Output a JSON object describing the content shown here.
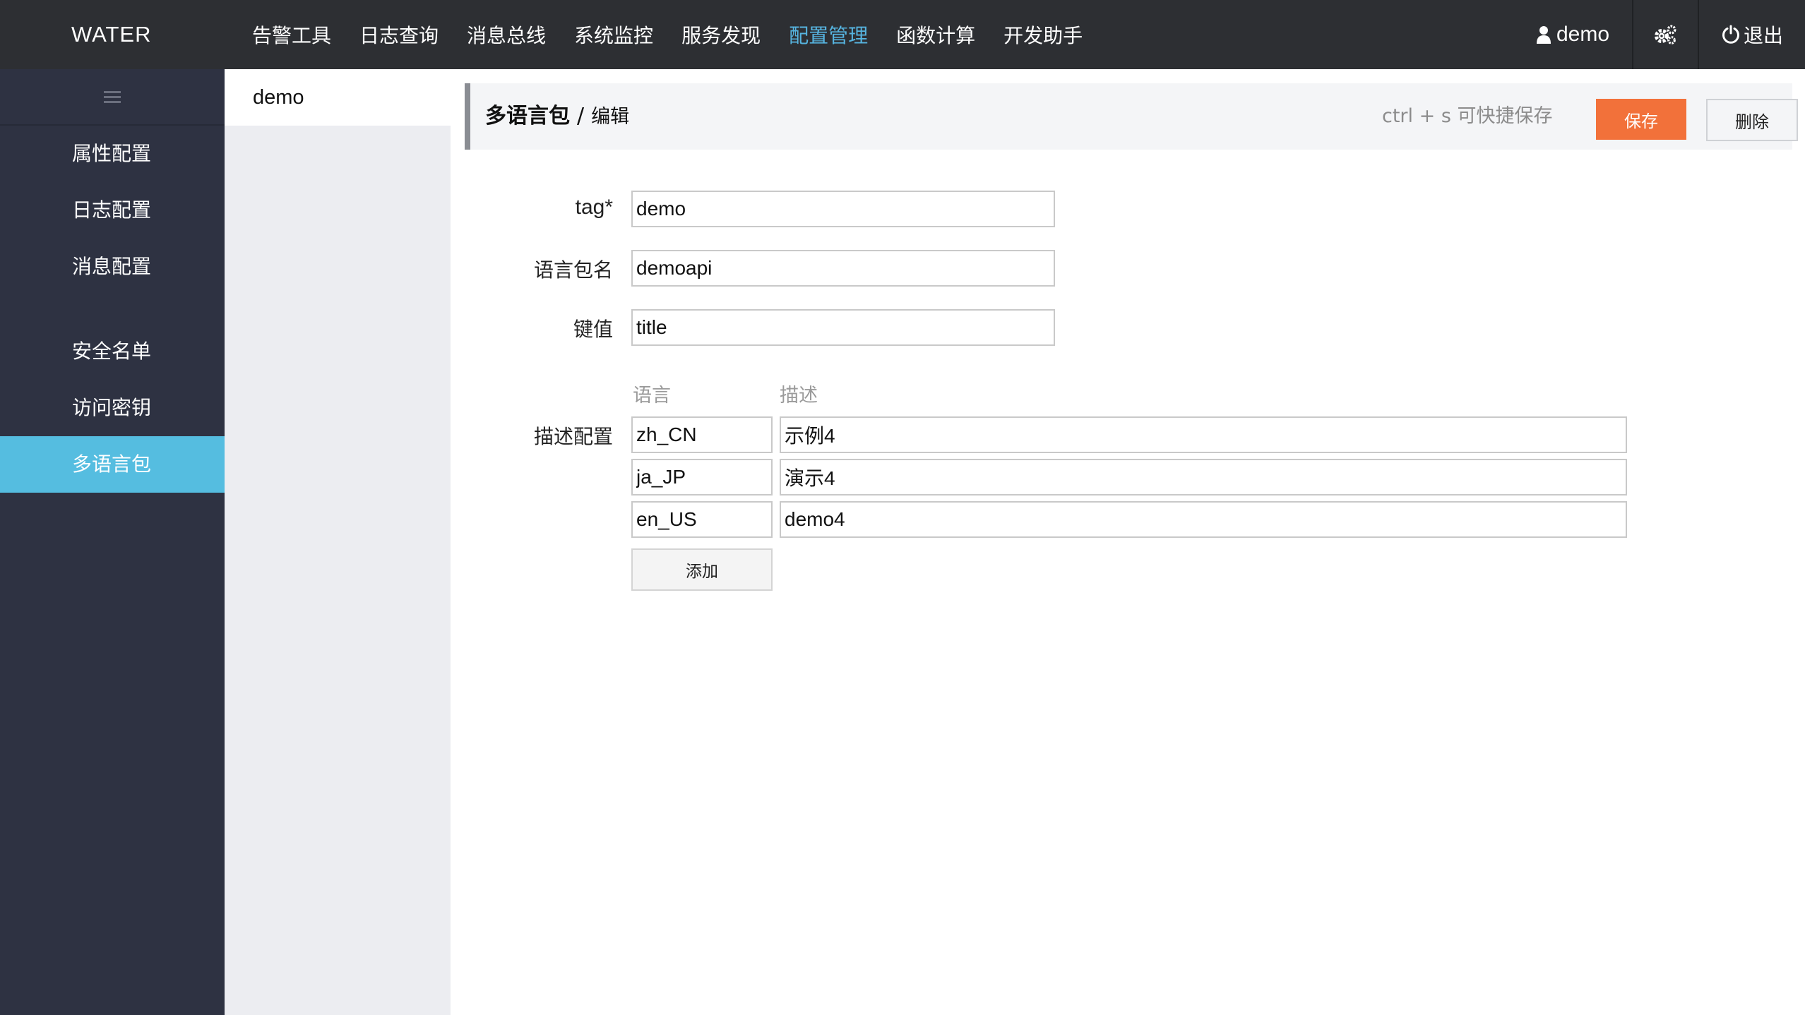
{
  "header": {
    "brand": "WATER",
    "nav": [
      {
        "label": "告警工具",
        "active": false
      },
      {
        "label": "日志查询",
        "active": false
      },
      {
        "label": "消息总线",
        "active": false
      },
      {
        "label": "系统监控",
        "active": false
      },
      {
        "label": "服务发现",
        "active": false
      },
      {
        "label": "配置管理",
        "active": true
      },
      {
        "label": "函数计算",
        "active": false
      },
      {
        "label": "开发助手",
        "active": false
      }
    ],
    "user_name": "demo",
    "user_icon": "user-icon",
    "settings_icon": "gears-icon",
    "logout_label": "退出",
    "logout_icon": "power-icon"
  },
  "sidebar": {
    "toggle_icon": "hamburger-icon",
    "items": [
      {
        "label": "属性配置",
        "active": false
      },
      {
        "label": "日志配置",
        "active": false
      },
      {
        "label": "消息配置",
        "active": false
      },
      {
        "label": "安全名单",
        "active": false
      },
      {
        "label": "访问密钥",
        "active": false
      },
      {
        "label": "多语言包",
        "active": true
      }
    ]
  },
  "list": {
    "items": [
      {
        "label": "demo",
        "selected": true
      }
    ]
  },
  "editor": {
    "title": "多语言包",
    "separator": "/",
    "subtitle": "编辑",
    "shortcut_hint": "ctrl + s 可快捷保存",
    "save_label": "保存",
    "delete_label": "删除",
    "fields": {
      "tag": {
        "label": "tag*",
        "value": "demo"
      },
      "bundle": {
        "label": "语言包名",
        "value": "demoapi"
      },
      "key": {
        "label": "键值",
        "value": "title"
      }
    },
    "desc_config": {
      "label": "描述配置",
      "col_lang": "语言",
      "col_desc": "描述",
      "rows": [
        {
          "lang": "zh_CN",
          "desc": "示例4"
        },
        {
          "lang": "ja_JP",
          "desc": "演示4"
        },
        {
          "lang": "en_US",
          "desc": "demo4"
        }
      ],
      "add_label": "添加"
    }
  },
  "colors": {
    "topbar_bg": "#2d2f33",
    "sidebar_bg": "#2e3242",
    "sidebar_active": "#55bde0",
    "nav_active": "#56b4e0",
    "save_button": "#f2713a"
  }
}
